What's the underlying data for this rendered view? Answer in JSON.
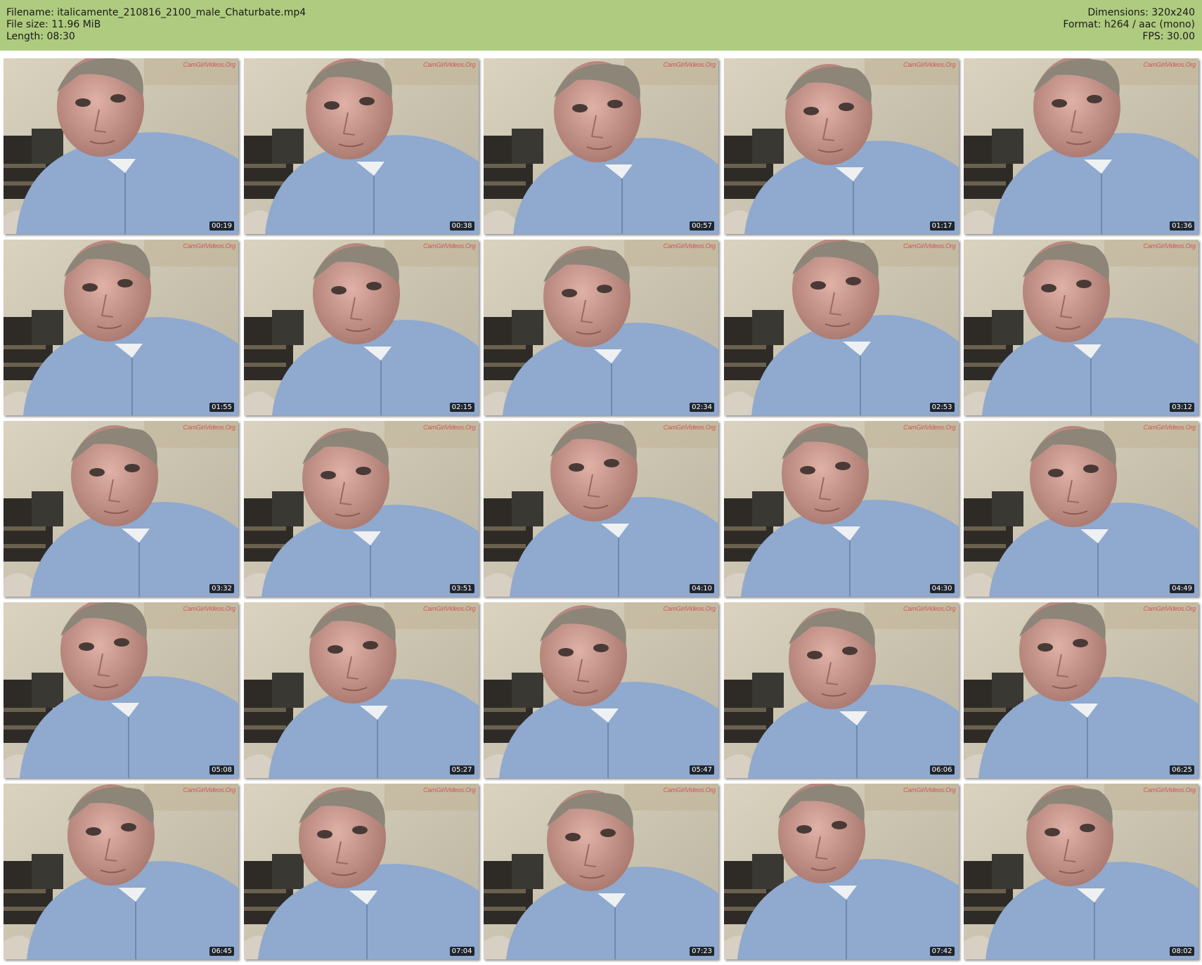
{
  "header": {
    "left": [
      "Filename: italicamente_210816_2100_male_Chaturbate.mp4",
      "File size: 11.96 MiB",
      "Length: 08:30"
    ],
    "right": [
      "Dimensions: 320x240",
      "Format: h264 / aac (mono)",
      "FPS: 30.00"
    ]
  },
  "watermark": "CamGirlVideos.Org",
  "colors": {
    "header_bg": "#afcb7f",
    "shirt": "#8fa9cf",
    "wall": "#d9d3bf",
    "skin": "#c9958a"
  },
  "thumbnails": [
    {
      "time": "00:19"
    },
    {
      "time": "00:38"
    },
    {
      "time": "00:57"
    },
    {
      "time": "01:17"
    },
    {
      "time": "01:36"
    },
    {
      "time": "01:55"
    },
    {
      "time": "02:15"
    },
    {
      "time": "02:34"
    },
    {
      "time": "02:53"
    },
    {
      "time": "03:12"
    },
    {
      "time": "03:32"
    },
    {
      "time": "03:51"
    },
    {
      "time": "04:10"
    },
    {
      "time": "04:30"
    },
    {
      "time": "04:49"
    },
    {
      "time": "05:08"
    },
    {
      "time": "05:27"
    },
    {
      "time": "05:47"
    },
    {
      "time": "06:06"
    },
    {
      "time": "06:25"
    },
    {
      "time": "06:45"
    },
    {
      "time": "07:04"
    },
    {
      "time": "07:23"
    },
    {
      "time": "07:42"
    },
    {
      "time": "08:02"
    }
  ]
}
